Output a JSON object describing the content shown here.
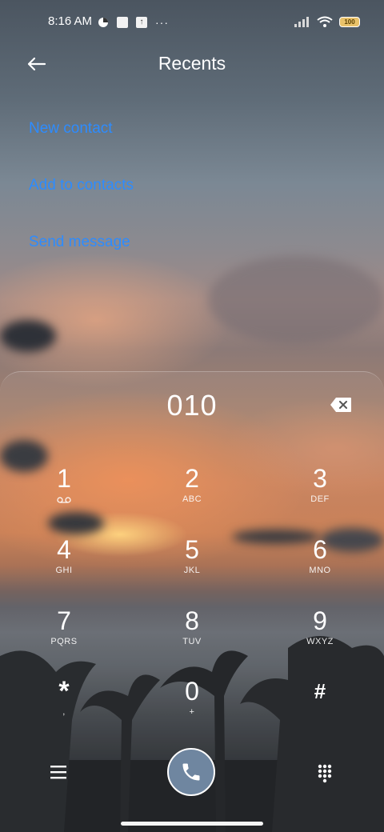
{
  "status_bar": {
    "time": "8:16 AM",
    "icons": [
      "app-notification-icon",
      "image-notification-icon",
      "upload-notification-icon",
      "more-dots"
    ],
    "more": "···",
    "battery": "100"
  },
  "header": {
    "title": "Recents",
    "back_icon": "arrow-left-icon"
  },
  "actions": [
    {
      "label": "New contact"
    },
    {
      "label": "Add to contacts"
    },
    {
      "label": "Send message"
    }
  ],
  "dialer": {
    "number": "010",
    "keys": [
      {
        "digit": "1",
        "letters": "",
        "sub_icon": "voicemail-icon"
      },
      {
        "digit": "2",
        "letters": "ABC"
      },
      {
        "digit": "3",
        "letters": "DEF"
      },
      {
        "digit": "4",
        "letters": "GHI"
      },
      {
        "digit": "5",
        "letters": "JKL"
      },
      {
        "digit": "6",
        "letters": "MNO"
      },
      {
        "digit": "7",
        "letters": "PQRS"
      },
      {
        "digit": "8",
        "letters": "TUV"
      },
      {
        "digit": "9",
        "letters": "WXYZ"
      },
      {
        "digit": "*",
        "letters": ","
      },
      {
        "digit": "0",
        "letters": "+"
      },
      {
        "digit": "#",
        "letters": ""
      }
    ]
  },
  "colors": {
    "accent": "#2d8cff",
    "call_button": "#6f86a0"
  }
}
